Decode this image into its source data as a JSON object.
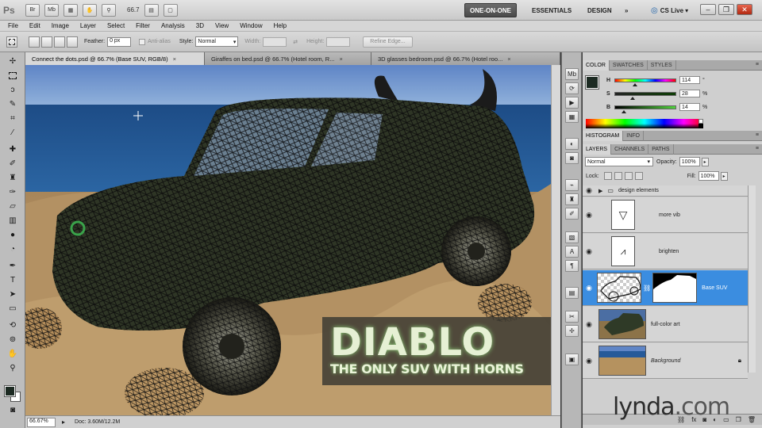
{
  "appbar": {
    "logo": "Ps",
    "bridge": "Br",
    "minibridge": "Mb",
    "zoom": "66.7",
    "workspaces": [
      "ONE-ON-ONE",
      "ESSENTIALS",
      "DESIGN"
    ],
    "more": "»",
    "cslive": "CS Live"
  },
  "menu": [
    "File",
    "Edit",
    "Image",
    "Layer",
    "Select",
    "Filter",
    "Analysis",
    "3D",
    "View",
    "Window",
    "Help"
  ],
  "options": {
    "feather_label": "Feather:",
    "feather_value": "0 px",
    "antialias": "Anti-alias",
    "style_label": "Style:",
    "style_value": "Normal",
    "width_label": "Width:",
    "height_label": "Height:",
    "refine": "Refine Edge..."
  },
  "tabs": [
    {
      "label": "Connect the dots.psd @ 66.7% (Base SUV, RGB/8)",
      "active": true
    },
    {
      "label": "Giraffes on bed.psd @ 66.7% (Hotel room, R...",
      "active": false
    },
    {
      "label": "3D glasses bedroom.psd @ 66.7% (Hotel roo...",
      "active": false
    }
  ],
  "canvas": {
    "headline": "DIABLO",
    "tagline": "THE ONLY SUV WITH HORNS"
  },
  "status": {
    "zoom": "66.67%",
    "doc": "Doc: 3.60M/12.2M"
  },
  "color_panel": {
    "tabs": [
      "COLOR",
      "SWATCHES",
      "STYLES"
    ],
    "h_label": "H",
    "h_value": "114",
    "h_unit": "°",
    "s_label": "S",
    "s_value": "28",
    "s_unit": "%",
    "b_label": "B",
    "b_value": "14",
    "b_unit": "%",
    "h_fraction": 0.32,
    "s_fraction": 0.28,
    "b_fraction": 0.14
  },
  "mid_tabs": [
    "HISTOGRAM",
    "INFO"
  ],
  "layers_panel": {
    "tabs": [
      "LAYERS",
      "CHANNELS",
      "PATHS"
    ],
    "blend": "Normal",
    "opacity_label": "Opacity:",
    "opacity": "100%",
    "lock_label": "Lock:",
    "fill_label": "Fill:",
    "fill": "100%",
    "group": "design elements",
    "layers": [
      {
        "name": "more vib"
      },
      {
        "name": "brighten"
      },
      {
        "name": "Base SUV"
      },
      {
        "name": "full-color art"
      },
      {
        "name": "Background"
      }
    ]
  },
  "colors": {
    "accent": "#3b8de0",
    "foreground": "#1c2a22"
  },
  "watermark": {
    "main": "lynda",
    "suffix": ".com"
  }
}
